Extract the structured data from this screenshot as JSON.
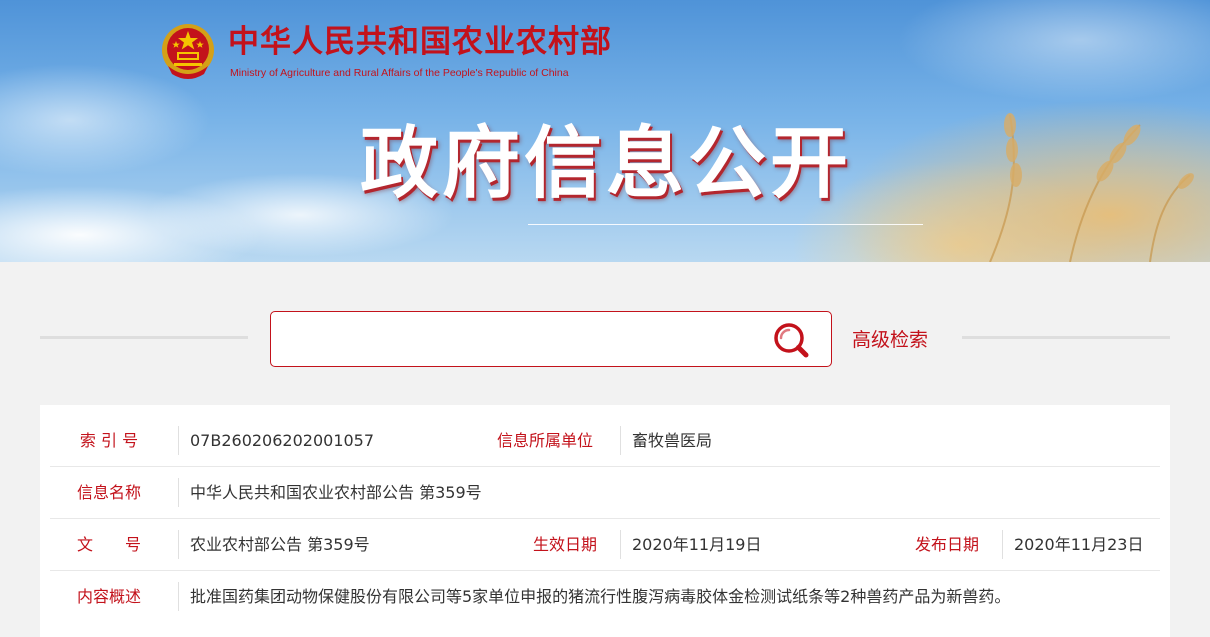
{
  "header": {
    "ministry_cn": "中华人民共和国农业农村部",
    "ministry_en": "Ministry of Agriculture and Rural Affairs of the People's Republic of China",
    "title": "政府信息公开",
    "icons": [
      "national-emblem-icon",
      "wheat-icon"
    ]
  },
  "search": {
    "value": "",
    "placeholder": "",
    "icon": "search-icon",
    "advanced_label": "高级检索"
  },
  "info": {
    "index_label": "索 引 号",
    "index_value": "07B260206202001057",
    "dept_label": "信息所属单位",
    "dept_value": "畜牧兽医局",
    "name_label": "信息名称",
    "name_value": "中华人民共和国农业农村部公告 第359号",
    "doc_label": "文　　号",
    "doc_value": "农业农村部公告 第359号",
    "effective_label": "生效日期",
    "effective_value": "2020年11月19日",
    "publish_label": "发布日期",
    "publish_value": "2020年11月23日",
    "summary_label": "内容概述",
    "summary_value": "批准国药集团动物保健股份有限公司等5家单位申报的猪流行性腹泻病毒胶体金检测试纸条等2种兽药产品为新兽药。"
  },
  "colors": {
    "brand_red": "#c3121b",
    "page_bg": "#f2f2f2",
    "text": "#333333"
  }
}
